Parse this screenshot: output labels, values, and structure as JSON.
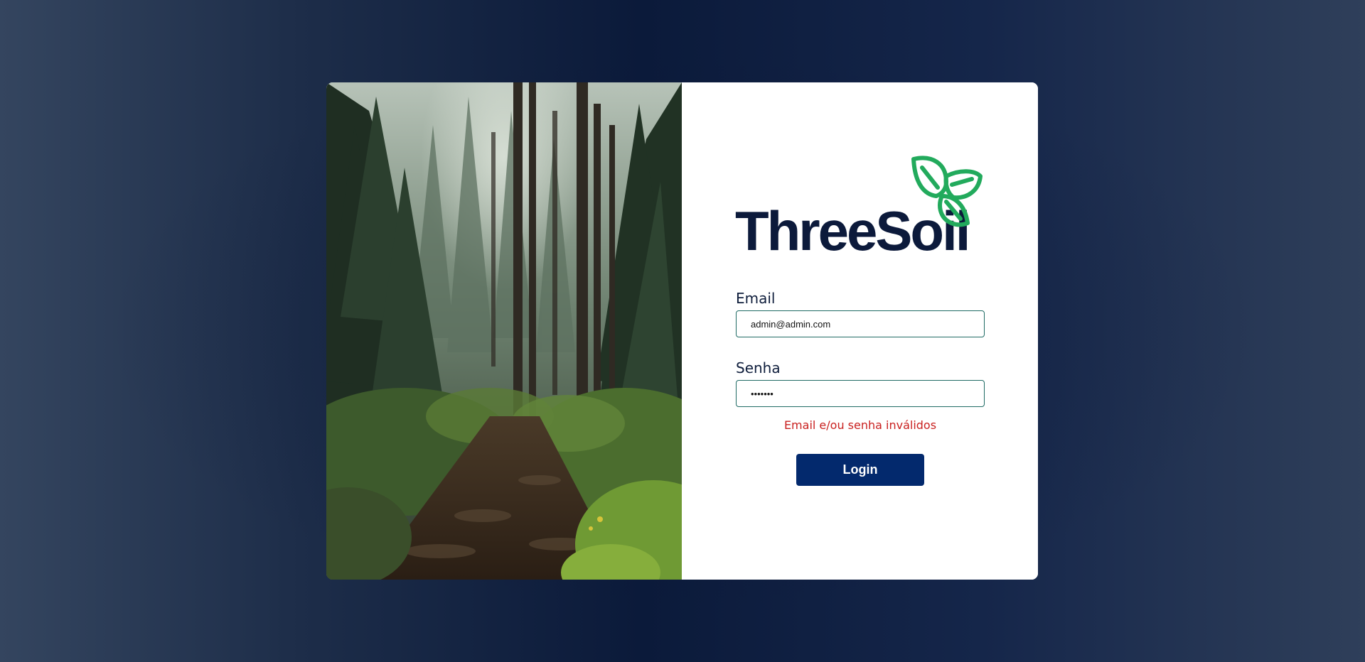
{
  "brand": {
    "name": "ThreeSoil",
    "primary_color": "#0c1a3b",
    "leaf_color": "#22aa5c",
    "logo_icon": "three-leaves-icon"
  },
  "hero_image": {
    "subject": "forest-trail-photo"
  },
  "form": {
    "email": {
      "label": "Email",
      "value": "admin@admin.com"
    },
    "password": {
      "label": "Senha",
      "value": "1234567"
    },
    "error_message": "Email e/ou senha inválidos",
    "error_color": "#c9201f",
    "submit_label": "Login",
    "submit_color": "#03296d"
  }
}
